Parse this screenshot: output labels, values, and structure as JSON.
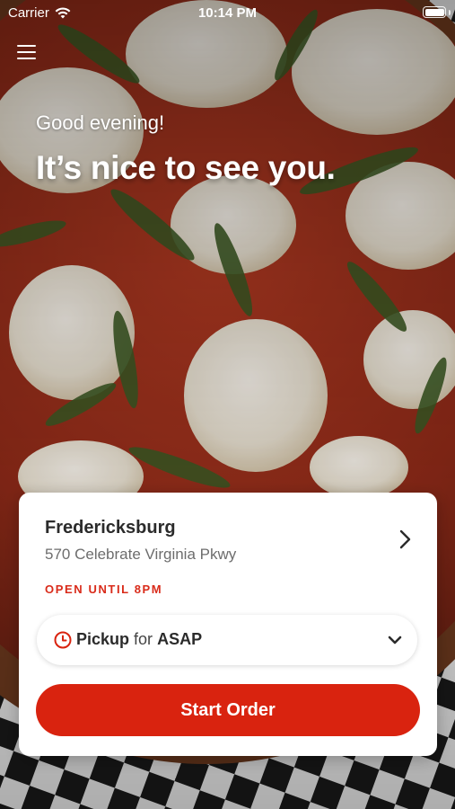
{
  "status_bar": {
    "carrier": "Carrier",
    "time": "10:14 PM",
    "icons": [
      "wifi-icon",
      "battery-icon"
    ]
  },
  "header": {
    "menu_icon": "hamburger-menu-icon",
    "greeting": "Good evening!",
    "headline": "It’s nice to see you."
  },
  "store_card": {
    "name": "Fredericksburg",
    "address": "570 Celebrate Virginia Pkwy",
    "status": "OPEN UNTIL 8PM",
    "chevron_icon": "chevron-right-icon"
  },
  "order_options": {
    "clock_icon": "clock-icon",
    "method": "Pickup",
    "connector": "for",
    "time": "ASAP",
    "dropdown_icon": "chevron-down-icon"
  },
  "cta": {
    "label": "Start Order"
  },
  "colors": {
    "accent": "#d9230f",
    "status_text": "#d92b1a",
    "card_bg": "#ffffff",
    "title_text": "#2b2b2b",
    "secondary_text": "#6d6d6d"
  }
}
